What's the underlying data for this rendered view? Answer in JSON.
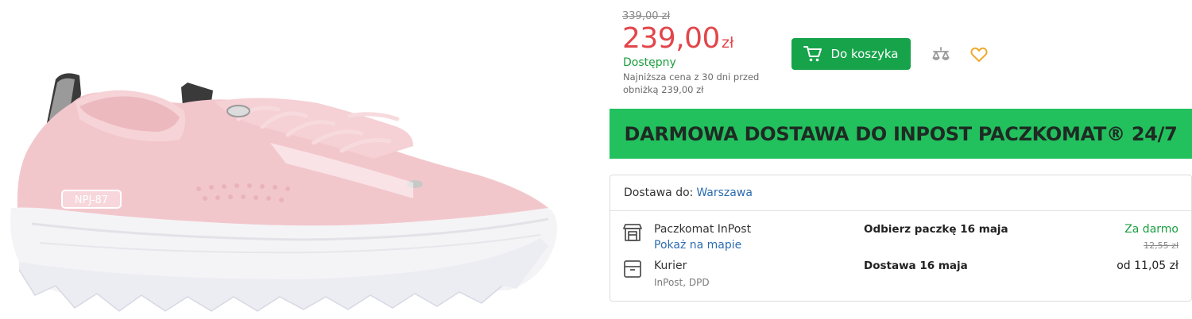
{
  "price": {
    "old": "339,00 zł",
    "value": "239,00",
    "currency": "zł",
    "availability": "Dostępny",
    "lowest_price_note": "Najniższa cena z 30 dni przed obniżką 239,00 zł"
  },
  "actions": {
    "add_to_cart_label": "Do koszyka",
    "cart_icon": "cart-icon",
    "compare_icon": "compare-icon",
    "wishlist_icon": "heart-icon"
  },
  "banner": {
    "text": "DARMOWA DOSTAWA DO INPOST PACZKOMAT® 24/7"
  },
  "delivery": {
    "header_label": "Dostawa do:",
    "city": "Warszawa",
    "options": [
      {
        "icon": "parcel-locker-icon",
        "name": "Paczkomat InPost",
        "sub": "Pokaż na mapie",
        "date": "Odbierz paczkę 16 maja",
        "price": "Za darmo",
        "old_price": "12,55 zł"
      },
      {
        "icon": "courier-box-icon",
        "name": "Kurier",
        "sub": "InPost, DPD",
        "date": "Dostawa 16 maja",
        "price": "od 11,05 zł"
      }
    ]
  },
  "product_image": {
    "alt": "NPJ-87",
    "colors": {
      "upper": "#f2c7cc",
      "sole": "#f4f4f6",
      "tread": "#ececf3",
      "accent": "#3a3a3a"
    }
  },
  "colors": {
    "price_red": "#e2464a",
    "green_button": "#16a34a",
    "banner_green": "#22c15e",
    "link_blue": "#2b6cb0",
    "available_green": "#1a9e3f"
  }
}
